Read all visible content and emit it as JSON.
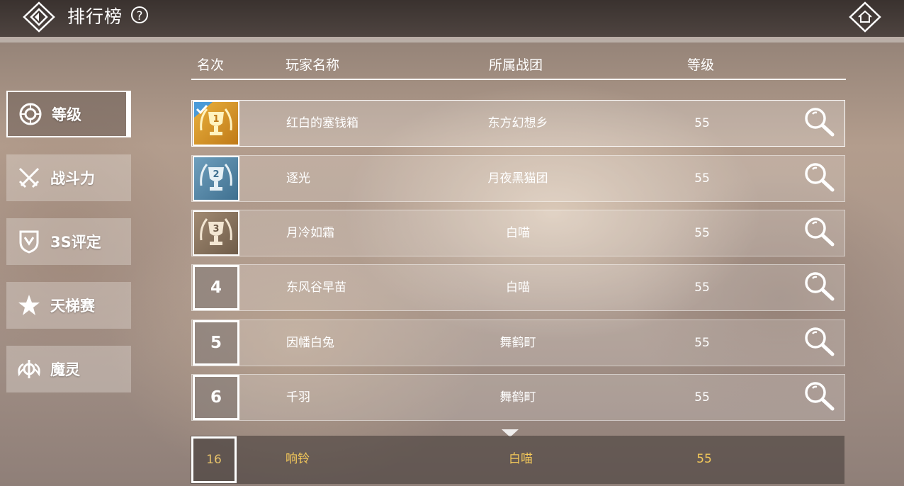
{
  "header": {
    "title": "排行榜",
    "help": "?"
  },
  "sidebar": {
    "tabs": [
      {
        "label": "等级",
        "icon": "gear-ring-icon",
        "active": true
      },
      {
        "label": "战斗力",
        "icon": "crossed-swords-icon",
        "active": false
      },
      {
        "label": "3S评定",
        "icon": "shield-crest-icon",
        "active": false
      },
      {
        "label": "天梯赛",
        "icon": "star-icon",
        "active": false
      },
      {
        "label": "魔灵",
        "icon": "winged-emblem-icon",
        "active": false
      }
    ]
  },
  "table": {
    "columns": [
      "名次",
      "玩家名称",
      "所属战团",
      "等级"
    ],
    "rows": [
      {
        "rank": "1",
        "name": "红白的塞钱箱",
        "guild": "东方幻想乡",
        "level": "55",
        "trophy": "gold"
      },
      {
        "rank": "2",
        "name": "逐光",
        "guild": "月夜黑猫团",
        "level": "55",
        "trophy": "silver"
      },
      {
        "rank": "3",
        "name": "月冷如霜",
        "guild": "白喵",
        "level": "55",
        "trophy": "bronze"
      },
      {
        "rank": "4",
        "name": "东风谷早苗",
        "guild": "白喵",
        "level": "55"
      },
      {
        "rank": "5",
        "name": "因幡白兔",
        "guild": "舞鹤町",
        "level": "55"
      },
      {
        "rank": "6",
        "name": "千羽",
        "guild": "舞鹤町",
        "level": "55"
      }
    ]
  },
  "self": {
    "rank": "16",
    "name": "响铃",
    "guild": "白喵",
    "level": "55"
  },
  "colors": {
    "gold": "#d89a2a",
    "silver": "#5b8fae",
    "bronze": "#8a7560",
    "self_text": "#f3c85a"
  }
}
